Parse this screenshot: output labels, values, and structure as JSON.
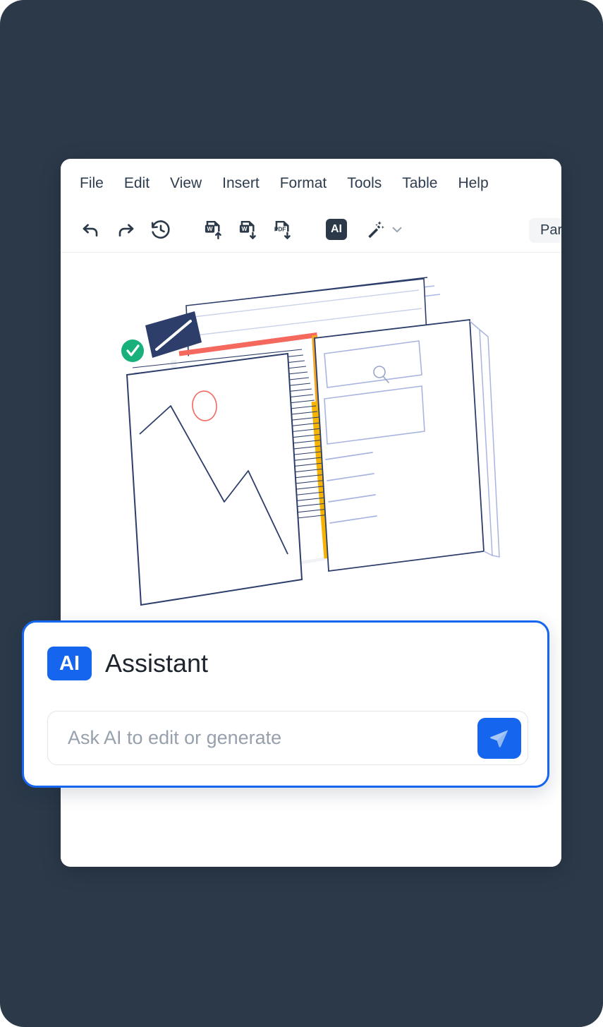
{
  "colors": {
    "page_background": "#2b3949",
    "window_background": "#ffffff",
    "accent_blue": "#1565ef",
    "toolbar_badge_dark": "#2b3949",
    "text_primary": "#2e3d4e",
    "placeholder_gray": "#97a0ad",
    "select_background": "#f4f5f7",
    "illustration_navy": "#2d3e6b",
    "illustration_green": "#18b07b",
    "illustration_red": "#f4685e",
    "illustration_orange": "#f5a623",
    "illustration_yellow": "#f6b400"
  },
  "menubar": {
    "items": [
      {
        "label": "File"
      },
      {
        "label": "Edit"
      },
      {
        "label": "View"
      },
      {
        "label": "Insert"
      },
      {
        "label": "Format"
      },
      {
        "label": "Tools"
      },
      {
        "label": "Table"
      },
      {
        "label": "Help"
      }
    ]
  },
  "toolbar": {
    "buttons": [
      {
        "name": "undo-icon",
        "title": "Undo"
      },
      {
        "name": "redo-icon",
        "title": "Redo"
      },
      {
        "name": "revision-history-icon",
        "title": "Revision history"
      },
      {
        "name": "import-word-icon",
        "title": "Import Word"
      },
      {
        "name": "export-word-icon",
        "title": "Export Word"
      },
      {
        "name": "export-pdf-icon",
        "title": "Export PDF"
      }
    ],
    "ai_badge_label": "AI",
    "magic_wand_icon": "magic-wand-icon",
    "chevron_icon": "chevron-down-icon",
    "style_select_value": "Paragraph"
  },
  "assistant": {
    "badge_label": "AI",
    "title": "Assistant",
    "input_value": "",
    "input_placeholder": "Ask AI to edit or generate",
    "send_icon": "send-paper-plane-icon"
  },
  "illustration": {
    "name": "stacked-documents-illustration",
    "badge_icon": "check-circle-icon",
    "search_icon": "search-icon",
    "photo_icon": "image-placeholder-icon"
  }
}
